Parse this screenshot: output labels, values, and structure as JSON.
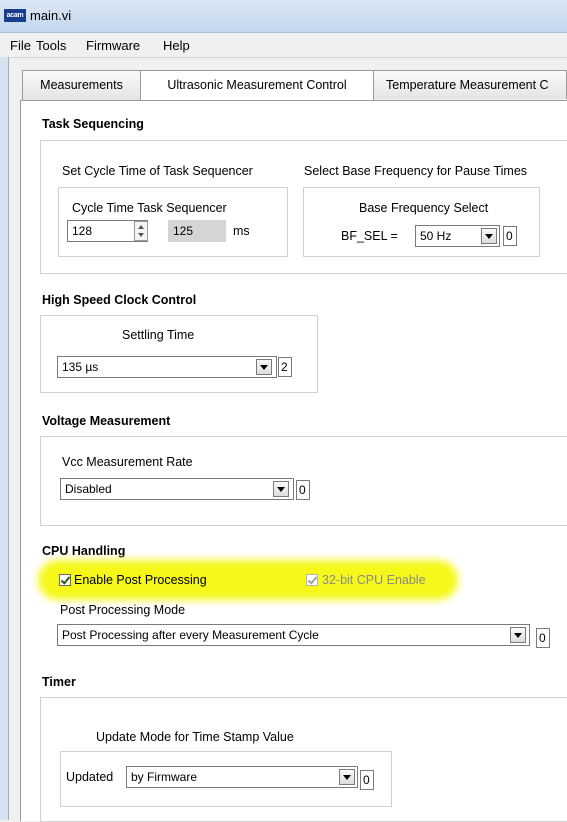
{
  "window": {
    "title": "main.vi",
    "logo_text": "acam"
  },
  "menu": [
    "File",
    "Tools",
    "Firmware",
    "Help"
  ],
  "tabs": [
    "Measurements",
    "Ultrasonic Measurement Control",
    "Temperature Measurement C"
  ],
  "task_sequencing": {
    "heading": "Task Sequencing",
    "cycle_group_label": "Set Cycle Time of Task Sequencer",
    "cycle_label": "Cycle Time Task Sequencer",
    "cycle_value": "128",
    "cycle_ms_value": "125",
    "cycle_unit": "ms",
    "freq_group_label": "Select Base Frequency for Pause Times",
    "freq_label": "Base Frequency Select",
    "bf_label": "BF_SEL =",
    "bf_value": "50 Hz",
    "bf_index": "0"
  },
  "clock": {
    "heading": "High Speed Clock Control",
    "settling_label": "Settling Time",
    "settling_value": "135 µs",
    "settling_index": "2"
  },
  "voltage": {
    "heading": "Voltage Measurement",
    "vcc_label": "Vcc Measurement Rate",
    "vcc_value": "Disabled",
    "vcc_index": "0"
  },
  "cpu": {
    "heading": "CPU Handling",
    "post_processing_label": "Enable Post Processing",
    "cpu32_label": "32-bit CPU Enable",
    "mode_label": "Post Processing Mode",
    "mode_value": "Post Processing after every Measurement Cycle",
    "mode_index": "0"
  },
  "timer": {
    "heading": "Timer",
    "update_group_label": "Update Mode for Time Stamp Value",
    "updated_label": "Updated",
    "updated_value": "by Firmware",
    "updated_index": "0"
  },
  "colors": {
    "highlight": "#f4f800",
    "titlebar": "#c4d7ee"
  }
}
